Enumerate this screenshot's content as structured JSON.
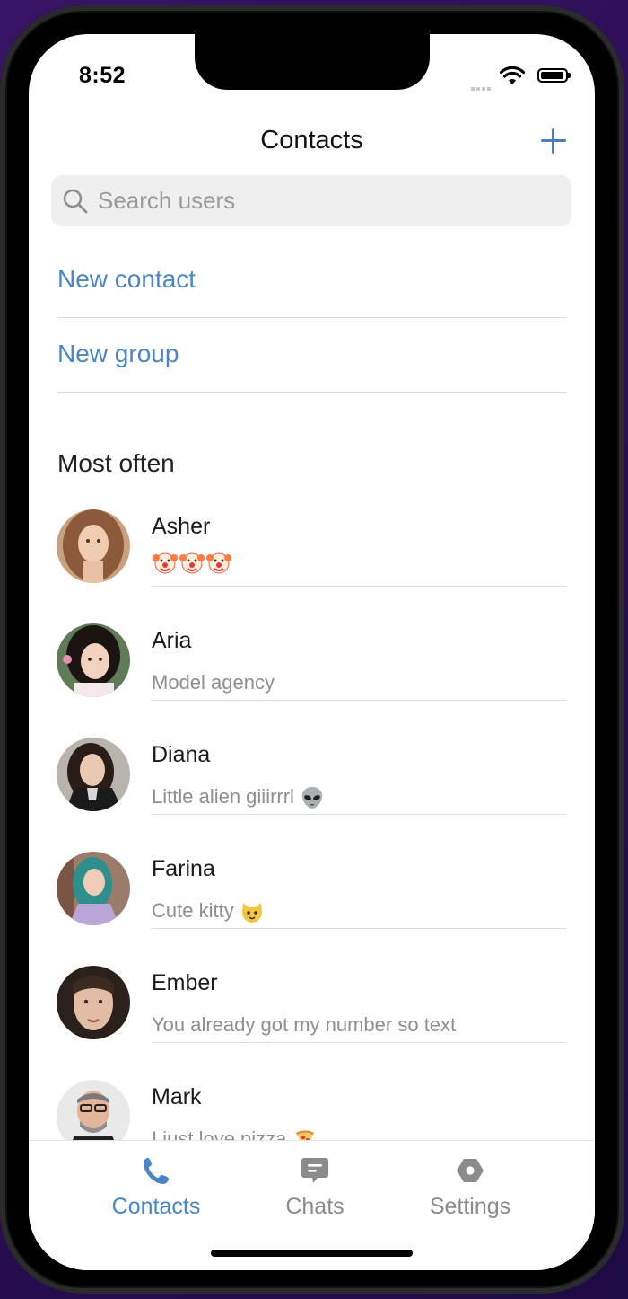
{
  "status_bar": {
    "time": "8:52"
  },
  "header": {
    "title": "Contacts"
  },
  "search": {
    "placeholder": "Search users"
  },
  "actions": {
    "new_contact": "New contact",
    "new_group": "New group"
  },
  "section": {
    "title": "Most often"
  },
  "contacts": [
    {
      "name": "Asher",
      "status": "",
      "emoji": "clown-face x3"
    },
    {
      "name": "Aria",
      "status": "Model agency"
    },
    {
      "name": "Diana",
      "status": "Little alien giiirrrl",
      "emoji": "alien"
    },
    {
      "name": "Farina",
      "status": "Cute kitty",
      "emoji": "cat-face"
    },
    {
      "name": "Ember",
      "status": "You already got my number so text"
    },
    {
      "name": "Mark",
      "status": "I just love pizza",
      "emoji": "pizza"
    }
  ],
  "tabs": [
    {
      "label": "Contacts",
      "icon": "phone-icon",
      "active": true
    },
    {
      "label": "Chats",
      "icon": "chat-bubble-icon",
      "active": false
    },
    {
      "label": "Settings",
      "icon": "settings-hexagon-icon",
      "active": false
    }
  ],
  "colors": {
    "accent": "#4a86c5",
    "muted": "#8e8e8e",
    "background": "#ffffff"
  }
}
